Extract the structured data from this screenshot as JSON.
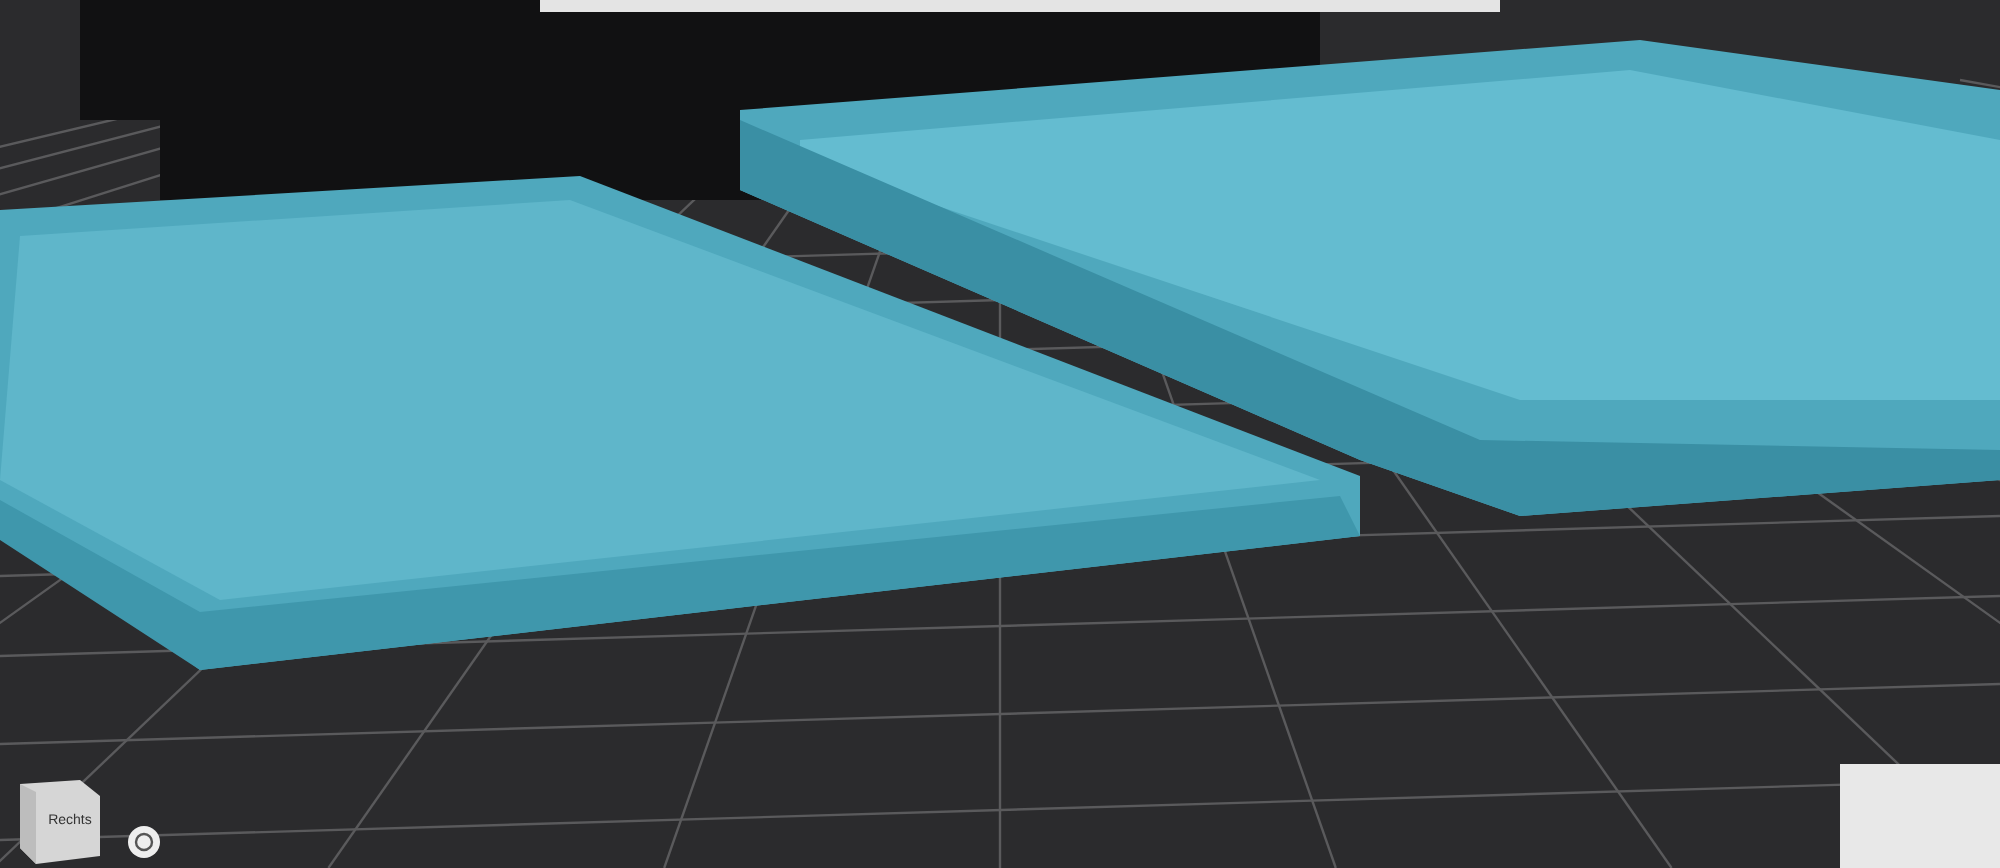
{
  "view_cube": {
    "face_label": "Rechts"
  }
}
